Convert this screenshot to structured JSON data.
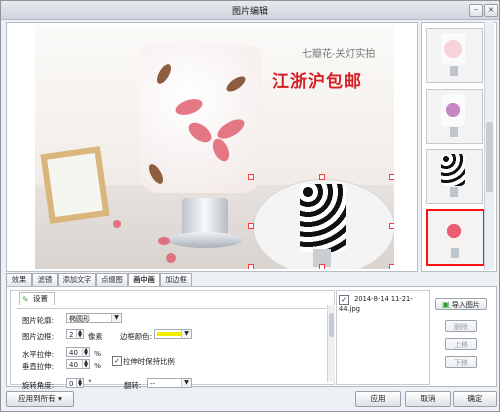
{
  "window": {
    "title": "图片编辑",
    "minimize": "–",
    "close": "×"
  },
  "preview": {
    "promo_line1": "七瓣花-关灯实拍",
    "promo_line2": "江浙沪包邮"
  },
  "tabs": [
    "效果",
    "滤镜",
    "添加文字",
    "点缀图",
    "画中画",
    "加边框"
  ],
  "active_tab": "画中画",
  "settings": {
    "tab_label": "设置",
    "outline_label": "图片轮廓:",
    "outline_value": "椭圆形",
    "border_label": "图片边框:",
    "border_value": "2",
    "border_unit": "像素",
    "border_color_label": "边框颜色:",
    "border_color": "#f4ec00",
    "h_stretch_label": "水平拉伸:",
    "h_stretch_value": "40",
    "v_stretch_label": "垂直拉伸:",
    "v_stretch_value": "40",
    "percent": "%",
    "keep_ratio_label": "拉伸时保持比例",
    "keep_ratio_checked": true,
    "rotate_label": "旋转角度:",
    "rotate_value": "0",
    "degree": "°",
    "flip_label": "翻转:",
    "flip_value": "--"
  },
  "file_list": {
    "items": [
      {
        "name": "2014-8-14 11-21-44.jpg",
        "checked": true
      }
    ]
  },
  "side_buttons": {
    "import": "导入图片",
    "delete": "删除",
    "up": "上移",
    "down": "下移"
  },
  "footer": {
    "apply_all": "应用到所有",
    "apply": "应用",
    "cancel": "取消",
    "ok": "确定"
  },
  "thumbnail_icons": [
    "lamp-thumbnail-pink",
    "lamp-thumbnail-purple",
    "lamp-thumbnail-cow",
    "lamp-thumbnail-flower"
  ]
}
